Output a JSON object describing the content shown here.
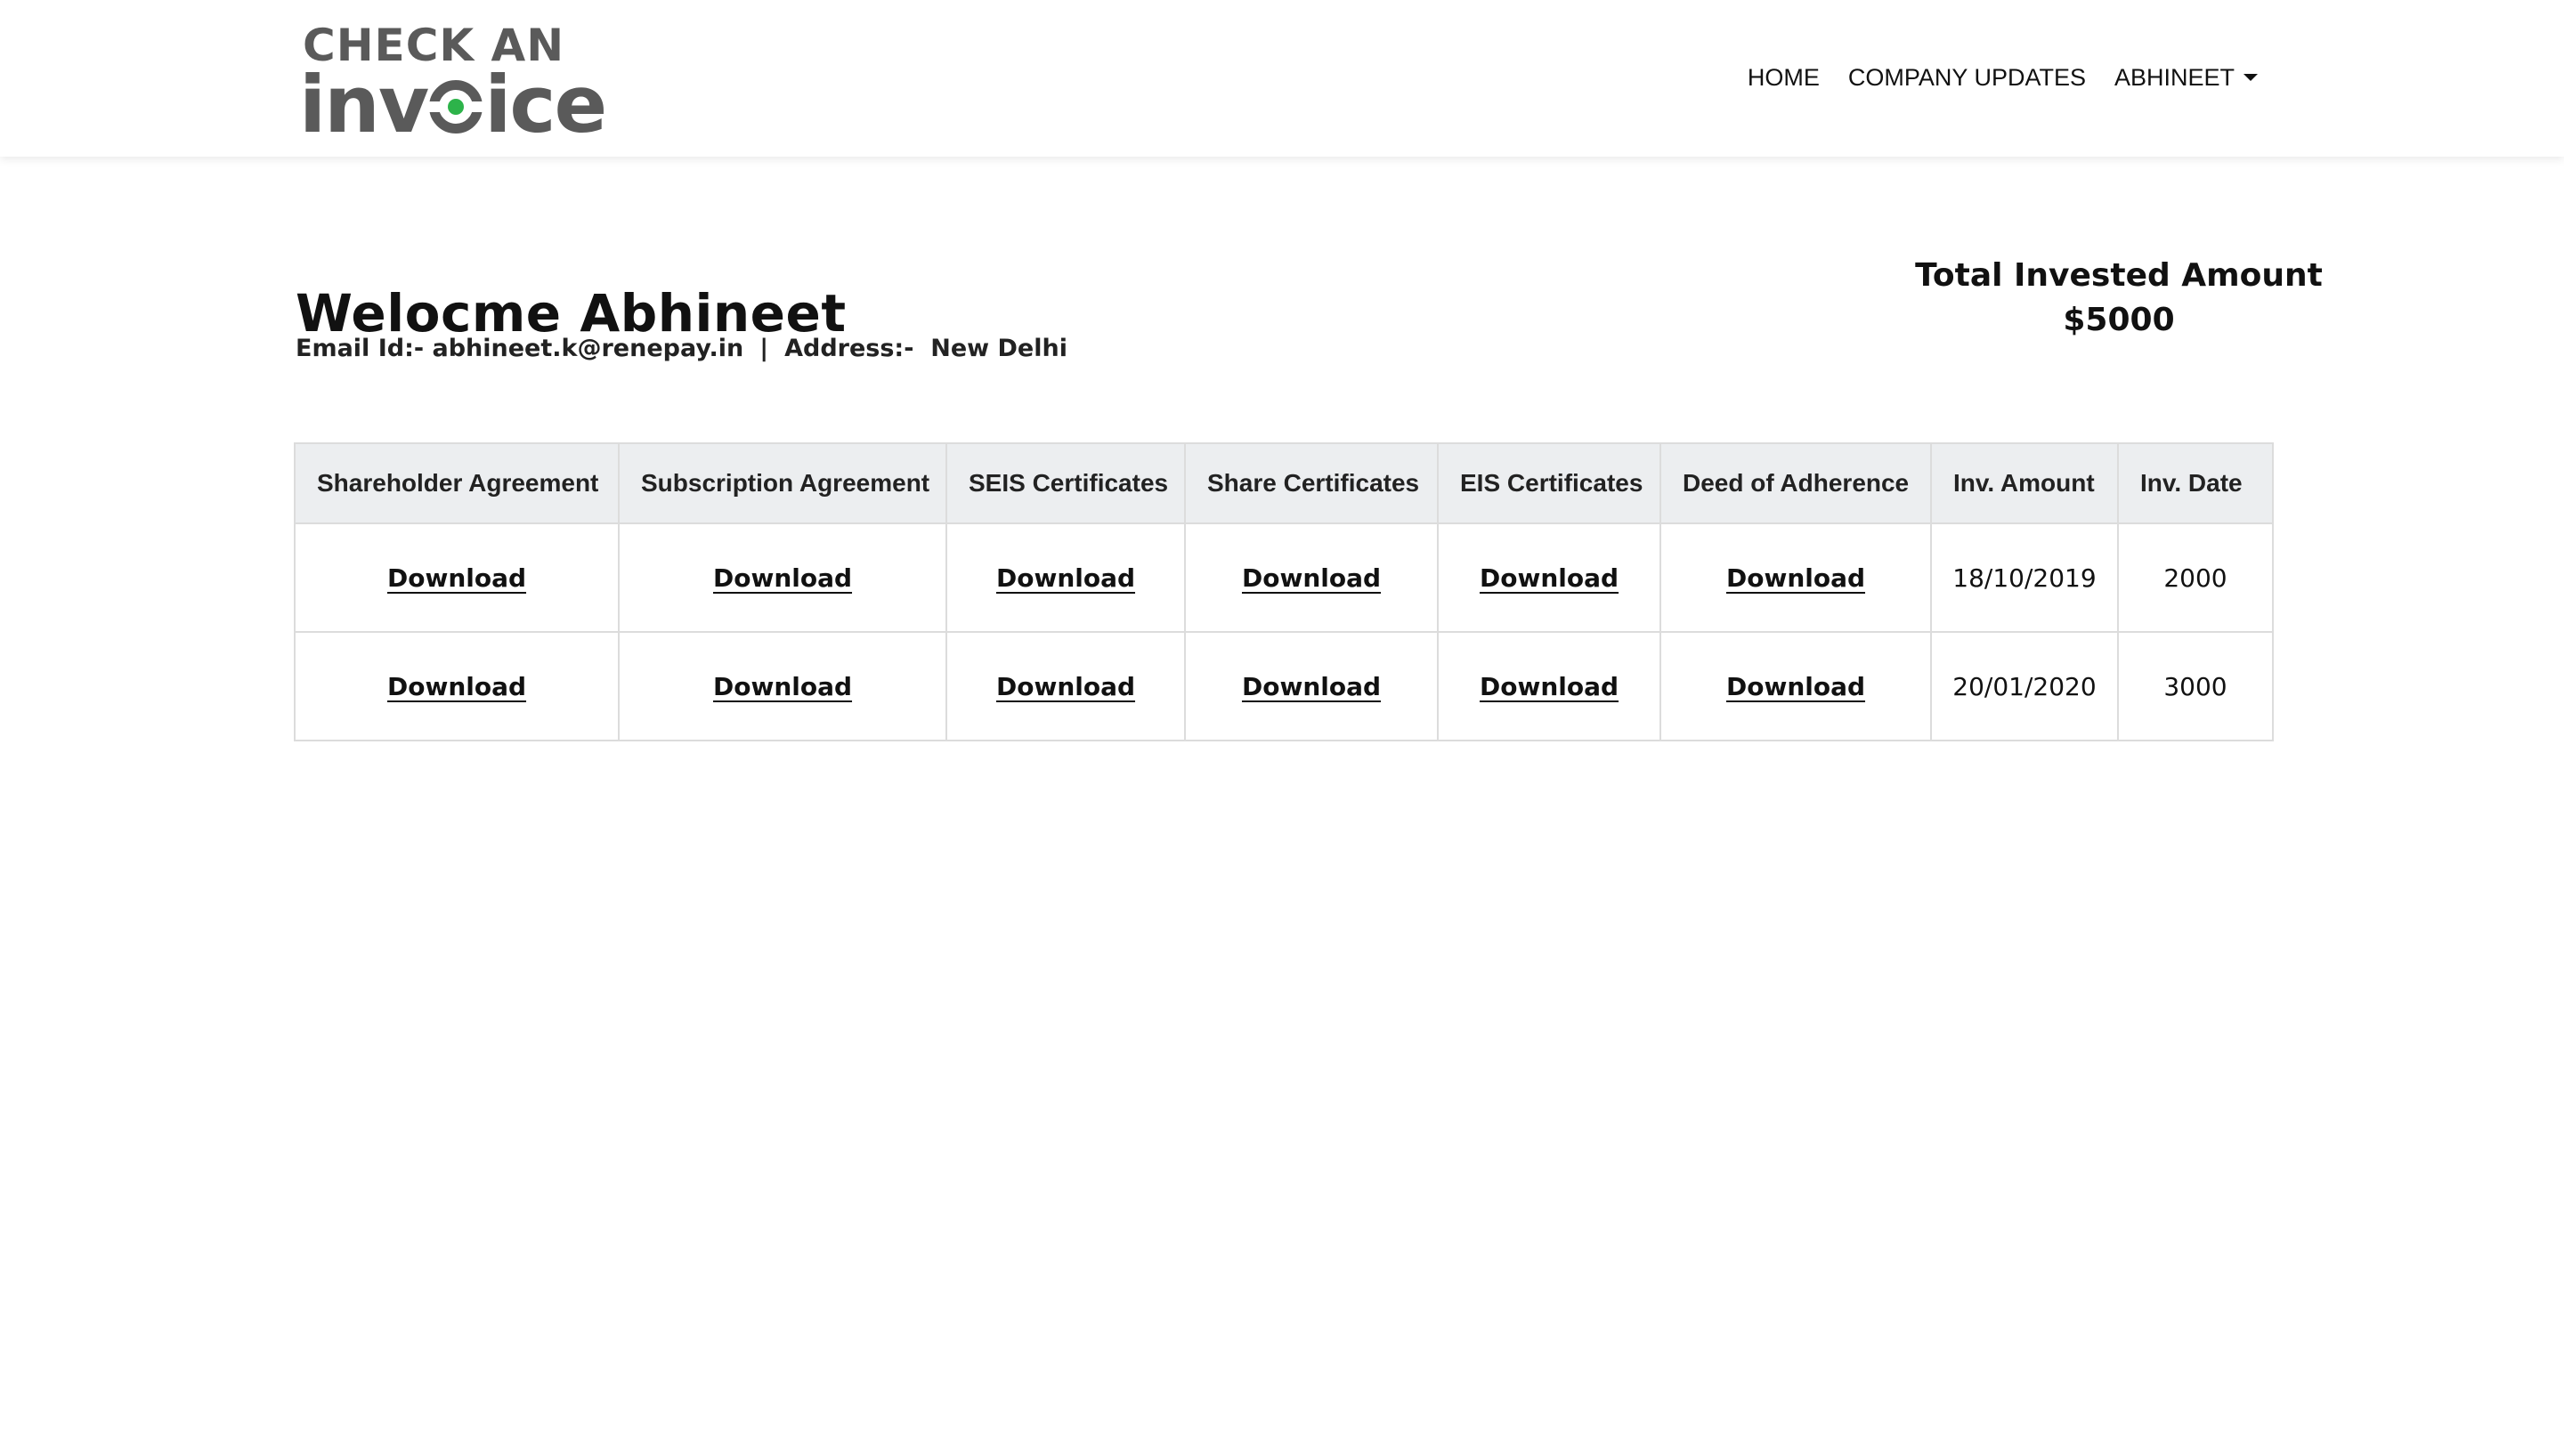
{
  "brand": {
    "logo_line1": "CHECK AN",
    "logo_line2_a": "inv",
    "logo_line2_b": "ice"
  },
  "nav": {
    "home": "HOME",
    "company_updates": "COMPANY UPDATES",
    "user_menu": "ABHINEET"
  },
  "welcome": {
    "heading": "Welocme Abhineet",
    "email_label": "Email Id:-",
    "email": "abhineet.k@renepay.in",
    "separator": "|",
    "address_label": "Address:-",
    "address": "New Delhi"
  },
  "total": {
    "label": "Total Invested Amount",
    "amount": "$5000"
  },
  "table": {
    "headers": [
      "Shareholder Agreement",
      "Subscription Agreement",
      "SEIS Certificates",
      "Share Certificates",
      "EIS Certificates",
      "Deed of Adherence",
      "Inv. Amount",
      "Inv. Date"
    ],
    "rows": [
      {
        "links": [
          "Download",
          "Download",
          "Download",
          "Download",
          "Download",
          "Download"
        ],
        "col7": "18/10/2019",
        "col8": "2000"
      },
      {
        "links": [
          "Download",
          "Download",
          "Download",
          "Download",
          "Download",
          "Download"
        ],
        "col7": "20/01/2020",
        "col8": "3000"
      }
    ]
  },
  "colors": {
    "accent": "#2db34a",
    "logo_gray": "#5a5a5a",
    "header_bg": "#eceef0",
    "border": "#dcdcdc"
  }
}
